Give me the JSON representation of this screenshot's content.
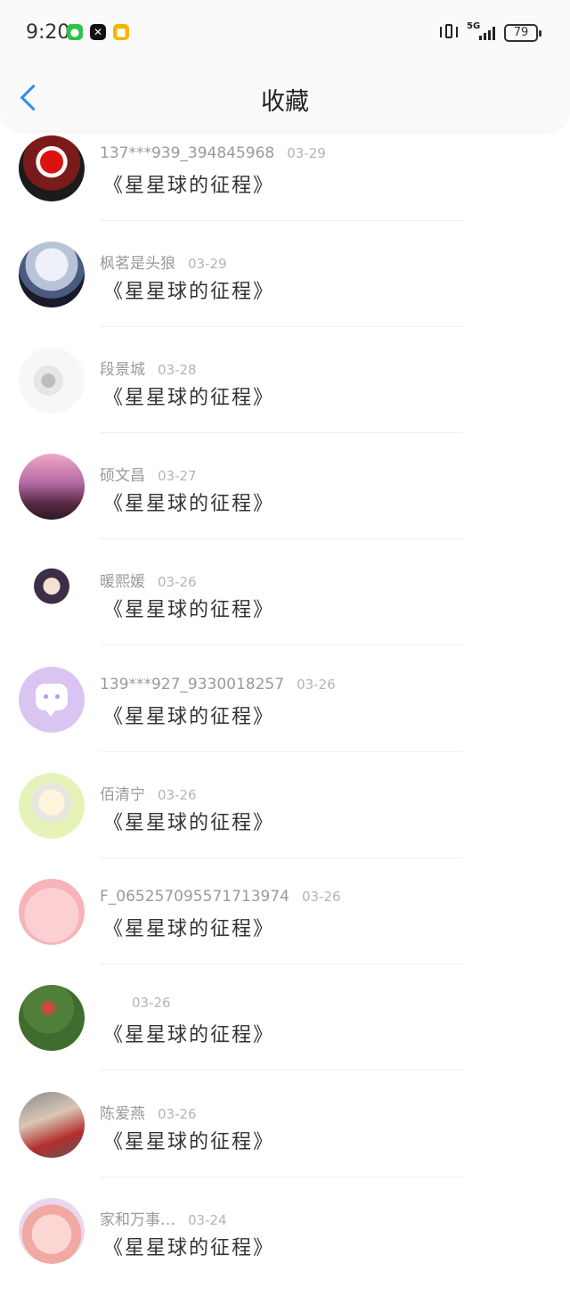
{
  "status_bar": {
    "time": "9:20",
    "apps": [
      "wechat-icon",
      "capcut-icon",
      "notes-icon"
    ],
    "network": "5G",
    "battery": "79"
  },
  "header": {
    "title": "收藏",
    "back_icon": "chevron-left-icon",
    "accent": "#2d8cf0"
  },
  "favorites": [
    {
      "user": "137***939_394845968",
      "date": "03-29",
      "title": "《星星球的征程》"
    },
    {
      "user": "枫茗是头狼",
      "date": "03-29",
      "title": "《星星球的征程》"
    },
    {
      "user": "段景城",
      "date": "03-28",
      "title": "《星星球的征程》"
    },
    {
      "user": "硕文昌",
      "date": "03-27",
      "title": "《星星球的征程》"
    },
    {
      "user": "暖熙媛",
      "date": "03-26",
      "title": "《星星球的征程》"
    },
    {
      "user": "139***927_9330018257",
      "date": "03-26",
      "title": "《星星球的征程》"
    },
    {
      "user": "佰清宁",
      "date": "03-26",
      "title": "《星星球的征程》"
    },
    {
      "user": "F_065257095571713974",
      "date": "03-26",
      "title": "《星星球的征程》"
    },
    {
      "user": "",
      "date": "03-26",
      "title": "《星星球的征程》"
    },
    {
      "user": "陈爱燕",
      "date": "03-26",
      "title": "《星星球的征程》"
    },
    {
      "user": "家和万事…",
      "date": "03-24",
      "title": "《星星球的征程》"
    }
  ]
}
